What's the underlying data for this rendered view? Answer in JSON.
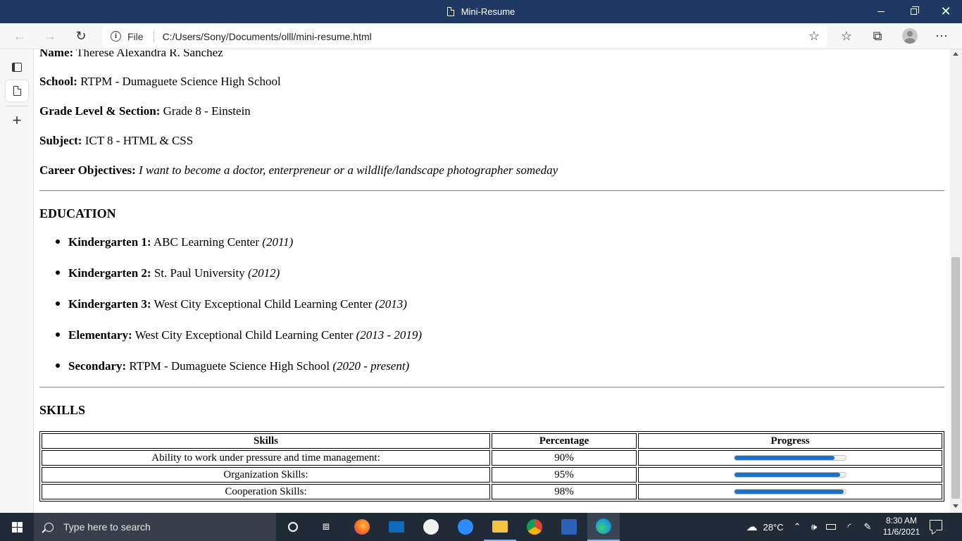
{
  "window": {
    "title": "Mini-Resume"
  },
  "browser": {
    "scheme_label": "File",
    "url": "C:/Users/Sony/Documents/olll/mini-resume.html"
  },
  "profile": {
    "name_label": "Name:",
    "name_value": "Therese Alexandra R. Sanchez",
    "school_label": "School:",
    "school_value": "RTPM - Dumaguete Science High School",
    "grade_label": "Grade Level & Section:",
    "grade_value": "Grade 8 - Einstein",
    "subject_label": "Subject:",
    "subject_value": "ICT 8 - HTML & CSS",
    "career_label": "Career Objectives:",
    "career_value": "I want to become a doctor, enterpreneur or a wildlife/landscape photographer someday"
  },
  "education": {
    "heading": "EDUCATION",
    "items": [
      {
        "label": "Kindergarten 1:",
        "school": "ABC Learning Center",
        "years": "(2011)"
      },
      {
        "label": "Kindergarten 2:",
        "school": "St. Paul University",
        "years": "(2012)"
      },
      {
        "label": "Kindergarten 3:",
        "school": "West City Exceptional Child Learning Center",
        "years": "(2013)"
      },
      {
        "label": "Elementary:",
        "school": "West City Exceptional Child Learning Center",
        "years": "(2013 - 2019)"
      },
      {
        "label": "Secondary:",
        "school": "RTPM - Dumaguete Science High School",
        "years": "(2020 - present)"
      }
    ]
  },
  "skills": {
    "heading": "SKILLS",
    "columns": [
      "Skills",
      "Percentage",
      "Progress"
    ],
    "rows": [
      {
        "skill": "Ability to work under pressure and time management:",
        "percentage": "90%",
        "progress": 0.9
      },
      {
        "skill": "Organization Skills:",
        "percentage": "95%",
        "progress": 0.95
      },
      {
        "skill": "Cooperation Skills:",
        "percentage": "98%",
        "progress": 0.98
      }
    ]
  },
  "taskbar": {
    "search_placeholder": "Type here to search",
    "weather": "28°C",
    "time": "8:30 AM",
    "date": "11/6/2021"
  },
  "colors": {
    "titlebar": "#1f3864",
    "progress_fill": "#1a73c5",
    "taskbar": "#212b38"
  },
  "icons": {
    "back": "arrow-left-icon",
    "forward": "arrow-right-icon",
    "refresh": "refresh-icon",
    "info": "info-icon",
    "favorites_add": "star-plus-icon",
    "favorites": "favorites-icon",
    "collections": "collections-icon",
    "profile": "avatar-icon",
    "more": "more-icon"
  }
}
